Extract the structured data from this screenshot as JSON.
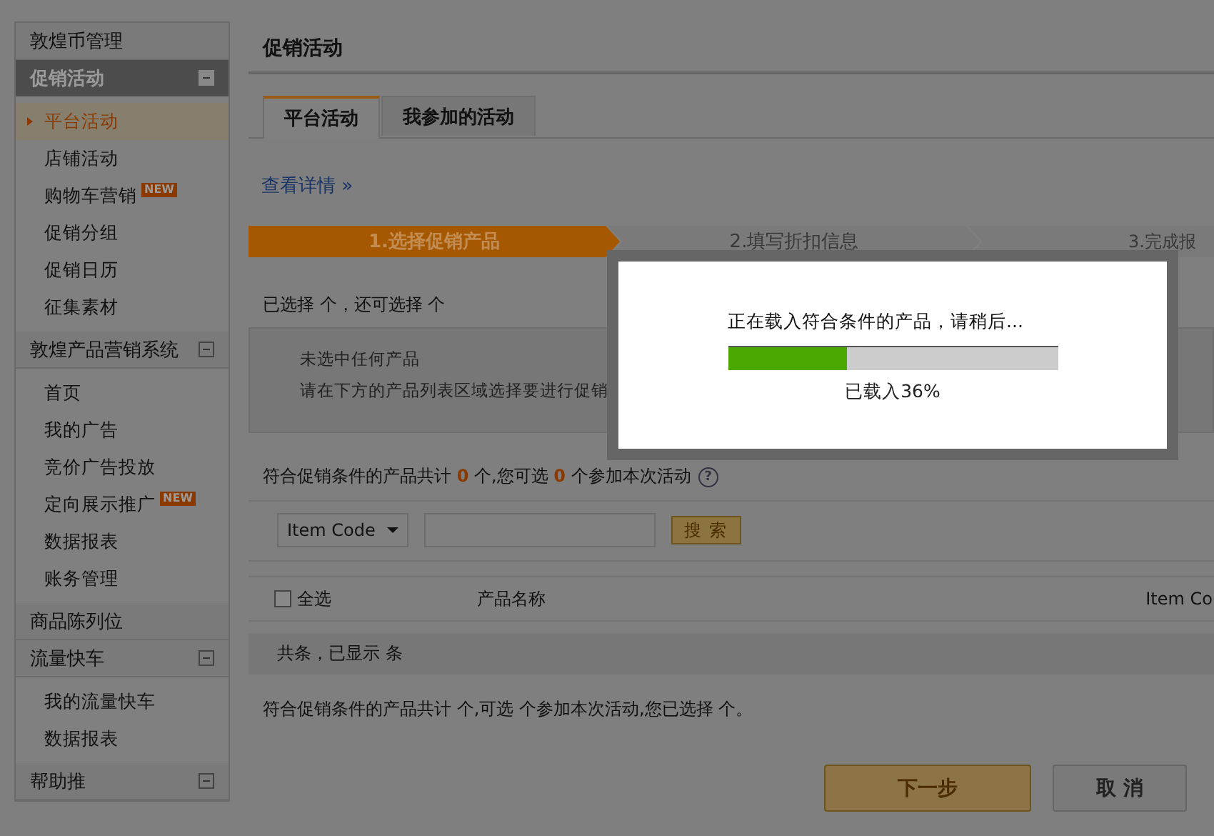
{
  "sidebar": {
    "groups": [
      {
        "kind": "link",
        "title": "敦煌币管理"
      },
      {
        "kind": "section",
        "title": "促销活动",
        "active": true,
        "expanded": true,
        "items": [
          {
            "label": "平台活动",
            "selected": true
          },
          {
            "label": "店铺活动",
            "selected": false
          },
          {
            "label": "购物车营销",
            "selected": false,
            "badge": "NEW"
          },
          {
            "label": "促销分组",
            "selected": false
          },
          {
            "label": "促销日历",
            "selected": false
          },
          {
            "label": "征集素材",
            "selected": false
          }
        ]
      },
      {
        "kind": "section",
        "title": "敦煌产品营销系统",
        "active": false,
        "expanded": true,
        "items": [
          {
            "label": "首页",
            "selected": false
          },
          {
            "label": "我的广告",
            "selected": false
          },
          {
            "label": "竞价广告投放",
            "selected": false
          },
          {
            "label": "定向展示推广",
            "selected": false,
            "badge": "NEW"
          },
          {
            "label": "数据报表",
            "selected": false
          },
          {
            "label": "账务管理",
            "selected": false
          }
        ]
      },
      {
        "kind": "link",
        "title": "商品陈列位"
      },
      {
        "kind": "section",
        "title": "流量快车",
        "active": false,
        "expanded": true,
        "items": [
          {
            "label": "我的流量快车",
            "selected": false
          },
          {
            "label": "数据报表",
            "selected": false
          }
        ]
      },
      {
        "kind": "section",
        "title": "帮助推",
        "active": false,
        "expanded": true
      }
    ]
  },
  "main": {
    "title": "促销活动",
    "tabs": [
      {
        "label": "平台活动",
        "selected": true
      },
      {
        "label": "我参加的活动",
        "selected": false
      }
    ],
    "details_link": "查看详情 »",
    "steps": [
      {
        "label": "1.选择促销产品",
        "selected": true
      },
      {
        "label": "2.填写折扣信息",
        "selected": false
      },
      {
        "label": "3.完成报",
        "selected": false
      }
    ],
    "selection_summary": "已选择 个，还可选择 个",
    "empty_notice": {
      "title": "未选中任何产品",
      "hint": "请在下方的产品列表区域选择要进行促销"
    },
    "eligible_count": "符合促销条件的产品共计 **0** 个,您可选 **0** 个参加本次活动",
    "help_icon": "?",
    "search": {
      "field": "Item Code",
      "button": "搜 索"
    },
    "table": {
      "select_all": {
        "label": "全选",
        "checked": false
      },
      "columns": [
        "产品名称",
        "Item Co"
      ],
      "footer": "共条，已显示 条"
    },
    "bottom_summary": "符合促销条件的产品共计 个,可选 个参加本次活动,您已选择 个。",
    "buttons": [
      {
        "label": "下一步",
        "kind": "primary"
      },
      {
        "label": "取 消",
        "kind": "secondary"
      }
    ]
  },
  "loading_dialog": {
    "message": "正在载入符合条件的产品，请稍后...",
    "level": 0.36,
    "reading": "已载入36%"
  }
}
